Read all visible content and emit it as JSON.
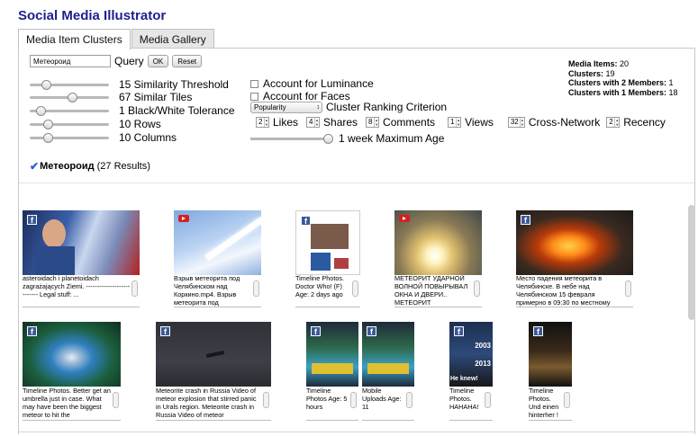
{
  "app": {
    "title": "Social Media Illustrator"
  },
  "tabs": [
    {
      "label": "Media Item Clusters",
      "active": true
    },
    {
      "label": "Media Gallery",
      "active": false
    }
  ],
  "query": {
    "value": "Метеороид",
    "label": "Query",
    "ok_label": "OK",
    "reset_label": "Reset"
  },
  "sliders": [
    {
      "value": 0.15,
      "label": "15 Similarity Threshold"
    },
    {
      "value": 0.67,
      "label": "67 Similar Tiles"
    },
    {
      "value": 0.1,
      "label": "1 Black/White Tolerance"
    },
    {
      "value": 0.2,
      "label": "10 Rows"
    },
    {
      "value": 0.2,
      "label": "10 Columns"
    }
  ],
  "options": {
    "luminance_label": "Account for Luminance",
    "faces_label": "Account for Faces",
    "ranking_value": "Popularity",
    "ranking_label": "Cluster Ranking Criterion"
  },
  "weights": [
    {
      "value": "2",
      "label": "Likes"
    },
    {
      "value": "4",
      "label": "Shares"
    },
    {
      "value": "8",
      "label": "Comments"
    },
    {
      "value": "1",
      "label": "Views"
    },
    {
      "value": "32",
      "label": "Cross-Network"
    },
    {
      "value": "2",
      "label": "Recency"
    }
  ],
  "age": {
    "value": 1.0,
    "label": "1 week Maximum Age"
  },
  "stats": [
    {
      "label": "Media Items:",
      "value": "20"
    },
    {
      "label": "Clusters:",
      "value": "19"
    },
    {
      "label": "Clusters with 2 Members:",
      "value": "1"
    },
    {
      "label": "Clusters with 1 Members:",
      "value": "18"
    }
  ],
  "cluster": {
    "title": "Метеороид",
    "count": "(27 Results)"
  },
  "media": [
    {
      "source": "facebook-icon",
      "caption": "asteroidach i planetoidach zagrażających Ziemi. --------------------------- Legal stuff: ..."
    },
    {
      "source": "youtube-icon",
      "caption": "Взрыв метеорита под Челябинском над Коркино.mp4. Взрыв метеорита под"
    },
    {
      "source": "facebook-icon",
      "caption": "Timeline Photos. Doctor Who! (F) Age: 2 days ago"
    },
    {
      "source": "youtube-icon",
      "caption": "МЕТЕОРИТ УДАРНОЙ ВОЛНОЙ ПОВЫРЫВАЛ ОКНА И ДВЕРИ.. МЕТЕОРИТ"
    },
    {
      "source": "facebook-icon",
      "caption": "Место падения метеорита в Челябинске. В небе над Челябинском 15 февраля примерно в 09:30 по местному"
    },
    {
      "source": "facebook-icon",
      "caption": "Timeline Photos. Better get an umbrella just in case. What may have been the biggest meteor to hit the"
    },
    {
      "source": "facebook-icon",
      "caption": "Meteorite crash in Russia Video of meteor explosion that stirred panic in Urals region. Meteorite crash in Russia Video of meteor"
    },
    {
      "source": "facebook-icon",
      "caption": "Timeline Photos Age: 5 hours"
    },
    {
      "source": "facebook-icon",
      "caption": "Mobile Uploads Age: 11"
    },
    {
      "source": "facebook-icon",
      "caption": "Timeline Photos. HAHAHA!"
    },
    {
      "source": "facebook-icon",
      "caption": "Timeline Photos. Und einen hinterher !"
    }
  ],
  "thumb_text": {
    "m10_a": "2003",
    "m10_b": "2013",
    "m10_c": "He knew!"
  },
  "colors": {
    "title": "#1f1f8f",
    "facebook": "#3b5998",
    "youtube": "#d42020",
    "check": "#2a5bd7"
  }
}
